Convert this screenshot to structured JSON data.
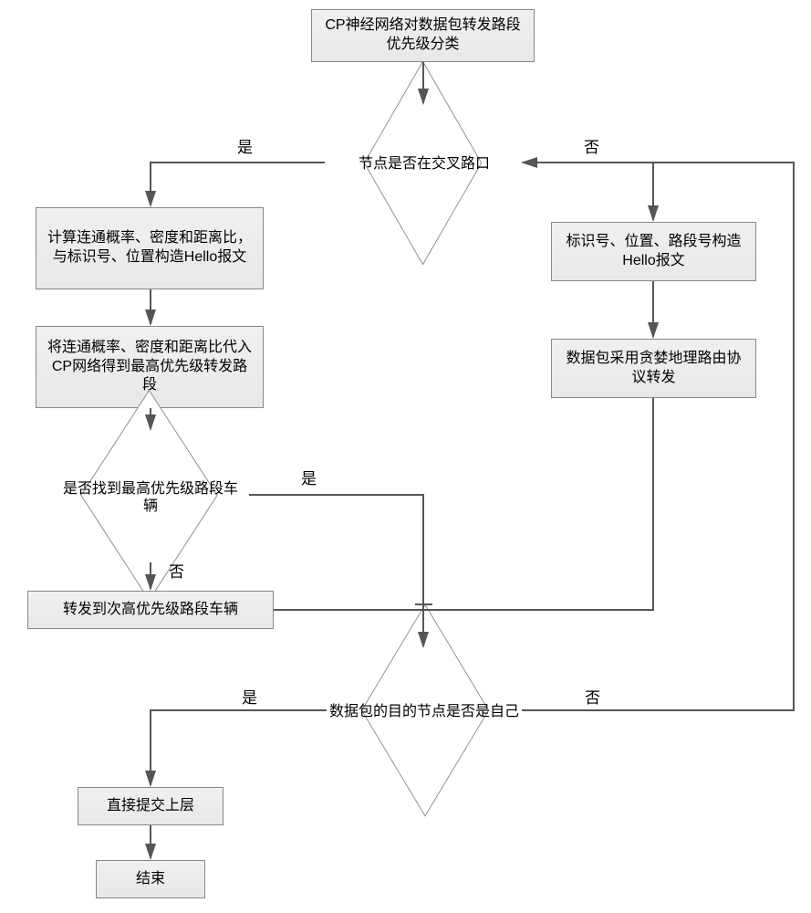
{
  "chart_data": {
    "type": "flowchart",
    "nodes": [
      {
        "id": "start",
        "type": "process",
        "text": "CP神经网络对数据包转发路段优先级分类"
      },
      {
        "id": "d1",
        "type": "decision",
        "text": "节点是否在交叉路口"
      },
      {
        "id": "p_yes1",
        "type": "process",
        "text": "计算连通概率、密度和距离比，与标识号、位置构造Hello报文"
      },
      {
        "id": "p_yes2",
        "type": "process",
        "text": "将连通概率、密度和距离比代入CP网络得到最高优先级转发路段"
      },
      {
        "id": "d2",
        "type": "decision",
        "text": "是否找到最高优先级路段车辆"
      },
      {
        "id": "p_yes3",
        "type": "process",
        "text": "转发到次高优先级路段车辆"
      },
      {
        "id": "p_no1",
        "type": "process",
        "text": "标识号、位置、路段号构造Hello报文"
      },
      {
        "id": "p_no2",
        "type": "process",
        "text": "数据包采用贪婪地理路由协议转发"
      },
      {
        "id": "d3",
        "type": "decision",
        "text": "数据包的目的节点是否是自己"
      },
      {
        "id": "p_end1",
        "type": "process",
        "text": "直接提交上层"
      },
      {
        "id": "end",
        "type": "process",
        "text": "结束"
      }
    ],
    "edges": [
      {
        "from": "start",
        "to": "d1"
      },
      {
        "from": "d1",
        "to": "p_yes1",
        "label": "是"
      },
      {
        "from": "d1",
        "to": "p_no1",
        "label": "否"
      },
      {
        "from": "p_yes1",
        "to": "p_yes2"
      },
      {
        "from": "p_yes2",
        "to": "d2"
      },
      {
        "from": "d2",
        "to": "merge",
        "label": "是"
      },
      {
        "from": "d2",
        "to": "p_yes3",
        "label": "否"
      },
      {
        "from": "p_yes3",
        "to": "merge"
      },
      {
        "from": "p_no1",
        "to": "p_no2"
      },
      {
        "from": "p_no2",
        "to": "merge"
      },
      {
        "from": "merge",
        "to": "d3"
      },
      {
        "from": "d3",
        "to": "p_end1",
        "label": "是"
      },
      {
        "from": "d3",
        "to": "d1",
        "label": "否"
      },
      {
        "from": "p_end1",
        "to": "end"
      }
    ]
  },
  "labels": {
    "yes": "是",
    "no": "否"
  },
  "boxes": {
    "start": "CP神经网络对数据包转发路段优先级分类",
    "d1": "节点是否在交叉路口",
    "p_yes1": "计算连通概率、密度和距离比，与标识号、位置构造Hello报文",
    "p_yes2": "将连通概率、密度和距离比代入CP网络得到最高优先级转发路段",
    "d2": "是否找到最高优先级路段车辆",
    "p_yes3": "转发到次高优先级路段车辆",
    "p_no1": "标识号、位置、路段号构造Hello报文",
    "p_no2": "数据包采用贪婪地理路由协议转发",
    "d3": "数据包的目的节点是否是自己",
    "p_end1": "直接提交上层",
    "end": "结束"
  }
}
